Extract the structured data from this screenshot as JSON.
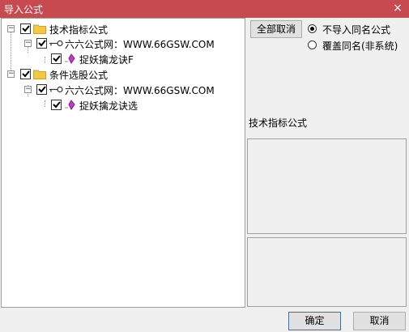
{
  "window": {
    "title": "导入公式",
    "close_glyph": "×"
  },
  "tree": {
    "nodes": [
      {
        "label": "技术指标公式",
        "expander": "−",
        "icon": "folder-icon"
      },
      {
        "label": "六六公式网：WWW.66GSW.COM",
        "expander": "−",
        "icon": "key-icon"
      },
      {
        "label": "捉妖擒龙诀F",
        "icon": "formula-icon"
      },
      {
        "label": "条件选股公式",
        "expander": "−",
        "icon": "folder-icon"
      },
      {
        "label": "六六公式网：WWW.66GSW.COM",
        "expander": "−",
        "icon": "key-icon"
      },
      {
        "label": "捉妖擒龙诀选",
        "icon": "formula-icon"
      }
    ]
  },
  "options": {
    "cancel_all_label": "全部取消",
    "radio_no_import": "不导入同名公式",
    "radio_overwrite": "覆盖同名(非系统)",
    "selected": "no_import"
  },
  "detail": {
    "label": "技术指标公式"
  },
  "footer": {
    "ok_label": "确定",
    "cancel_label": "取消"
  },
  "colors": {
    "titlebar": "#c84a51",
    "folder": "#f5c842",
    "formula": "#c43ac9"
  }
}
